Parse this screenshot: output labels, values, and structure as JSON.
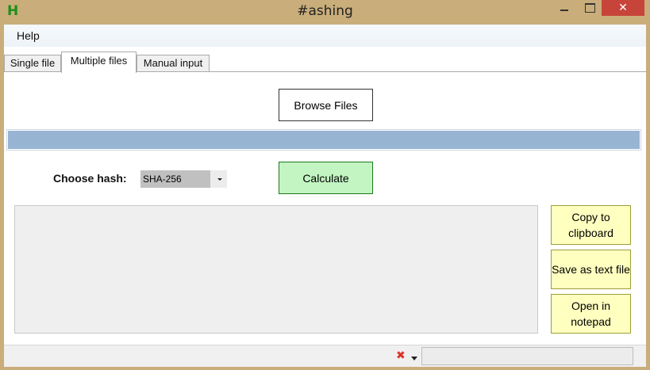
{
  "window": {
    "icon_letter": "H",
    "title": "#ashing",
    "close_glyph": "✕"
  },
  "menu": {
    "help": "Help"
  },
  "tabs": [
    {
      "label": "Single file",
      "active": false
    },
    {
      "label": "Multiple files",
      "active": true
    },
    {
      "label": "Manual input",
      "active": false
    }
  ],
  "browse": {
    "label": "Browse Files"
  },
  "progress": {
    "fraction": 1.0
  },
  "hash": {
    "label": "Choose hash:",
    "selected": "SHA-256"
  },
  "calculate": {
    "label": "Calculate"
  },
  "output": {
    "text": ""
  },
  "actions": {
    "copy": "Copy to clipboard",
    "save": "Save as text file",
    "notepad": "Open in notepad"
  },
  "status": {
    "error_glyph": "✖",
    "text": ""
  },
  "colors": {
    "title_bar": "#c9ad7a",
    "close_button": "#c7443a",
    "progress_fill": "#98b4d3",
    "calculate_bg": "#c2f5c2",
    "action_bg": "#ffffc0"
  }
}
